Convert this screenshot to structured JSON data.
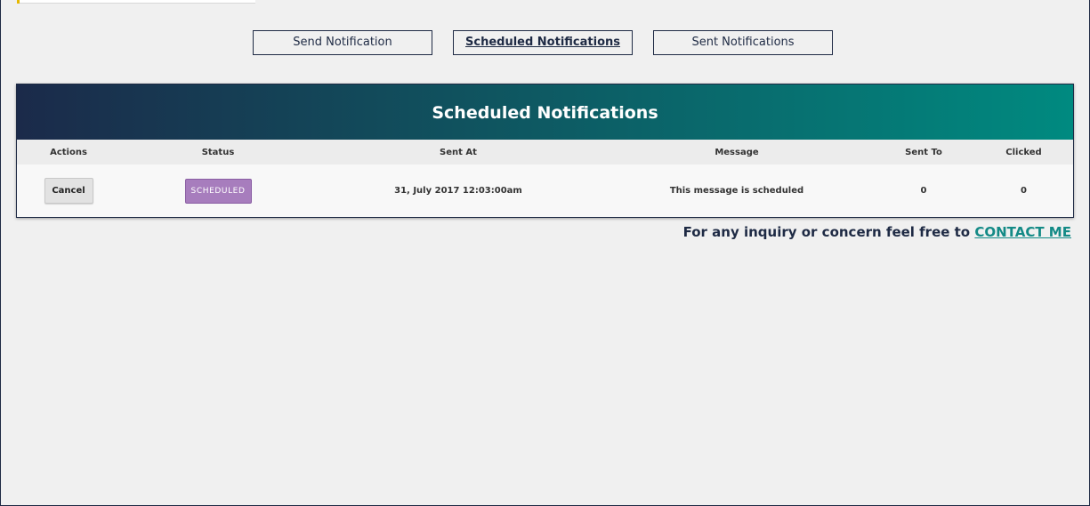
{
  "tabs": [
    {
      "label": "Send Notification",
      "active": false
    },
    {
      "label": "Scheduled Notifications",
      "active": true
    },
    {
      "label": "Sent Notifications",
      "active": false
    }
  ],
  "panel": {
    "title": "Scheduled Notifications",
    "columns": [
      "Actions",
      "Status",
      "Sent At",
      "Message",
      "Sent To",
      "Clicked"
    ],
    "rows": [
      {
        "action_label": "Cancel",
        "status": "SCHEDULED",
        "sent_at": "31, July 2017 12:03:00am",
        "message": "This message is scheduled",
        "sent_to": "0",
        "clicked": "0"
      }
    ]
  },
  "footer": {
    "text": "For any inquiry or concern feel free to",
    "link_label": "CONTACT ME"
  },
  "colors": {
    "header_gradient_start": "#1b2a4a",
    "header_gradient_end": "#008a80",
    "status_scheduled": "#a77dbd",
    "link": "#138a86"
  }
}
